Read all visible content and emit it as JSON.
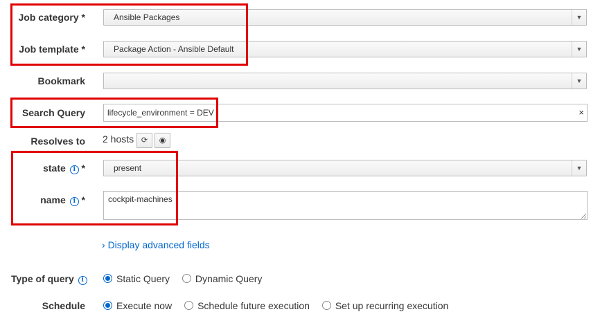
{
  "job_category": {
    "label": "Job category *",
    "value": "Ansible Packages"
  },
  "job_template": {
    "label": "Job template *",
    "value": "Package Action - Ansible Default"
  },
  "bookmark": {
    "label": "Bookmark",
    "value": ""
  },
  "search_query": {
    "label": "Search Query",
    "value": "lifecycle_environment = DEV",
    "clear_icon": "×"
  },
  "resolves": {
    "label": "Resolves to",
    "value": "2 hosts",
    "refresh_icon": "refresh-icon",
    "preview_icon": "eye-icon"
  },
  "state": {
    "label": "state",
    "required": "*",
    "value": "present"
  },
  "name": {
    "label": "name",
    "required": "*",
    "value": "cockpit-machines"
  },
  "advanced_link": "Display advanced fields",
  "type_of_query": {
    "label": "Type of query",
    "options": [
      "Static Query",
      "Dynamic Query"
    ],
    "selected": "Static Query"
  },
  "schedule": {
    "label": "Schedule",
    "options": [
      "Execute now",
      "Schedule future execution",
      "Set up recurring execution"
    ],
    "selected": "Execute now"
  },
  "colors": {
    "highlight": "#e00000",
    "link": "#0066cc"
  }
}
